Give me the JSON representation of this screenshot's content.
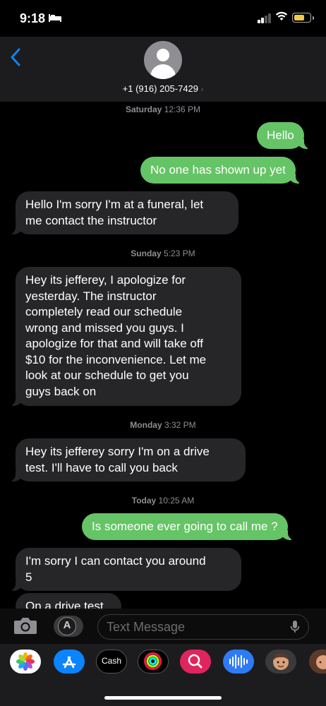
{
  "status_bar": {
    "time": "9:18"
  },
  "header": {
    "back_icon": "chevron-left-icon",
    "contact": "+1 (916) 205-7429",
    "contact_chevron": "›"
  },
  "conversation": [
    {
      "type": "timestamp",
      "day": "Saturday",
      "time": "12:36 PM"
    },
    {
      "type": "sent",
      "text": "Hello"
    },
    {
      "type": "sent",
      "text": "No one has shown up yet"
    },
    {
      "type": "received",
      "lines": [
        "Hello I'm sorry I'm at a funeral, let",
        "me contact the instructor"
      ]
    },
    {
      "type": "timestamp",
      "day": "Sunday",
      "time": "5:23 PM"
    },
    {
      "type": "received",
      "lines": [
        "Hey its jefferey, I apologize for",
        "yesterday. The instructor",
        "completely read our schedule",
        "wrong and missed you guys. I",
        "apologize for that and will take off",
        "$10 for the inconvenience. Let me",
        "look at our schedule to get you",
        "guys back on"
      ]
    },
    {
      "type": "timestamp",
      "day": "Monday",
      "time": "3:32 PM"
    },
    {
      "type": "received",
      "lines": [
        "Hey its jefferey sorry I'm on a drive",
        "test. I'll have to call you back"
      ]
    },
    {
      "type": "timestamp",
      "day": "Today",
      "time": "10:25 AM"
    },
    {
      "type": "sent",
      "text": "Is someone ever going to call me ?"
    },
    {
      "type": "received",
      "lines": [
        "I'm sorry I can contact you around",
        "5"
      ]
    },
    {
      "type": "received",
      "lines": [
        "On a drive test"
      ]
    }
  ],
  "input_bar": {
    "camera_icon": "camera-icon",
    "apps_icon": "app-store-icon",
    "placeholder": "Text Message",
    "mic_icon": "microphone-icon"
  },
  "app_drawer": {
    "apps": [
      "photos-icon",
      "app-store-icon",
      "cash-app-icon",
      "fitness-icon",
      "search-app-icon",
      "voice-memo-icon",
      "memoji-icon",
      "memoji-icon"
    ],
    "cash_label": "Cash"
  },
  "colors": {
    "sent_bubble": "#65c466",
    "received_bubble": "#262628",
    "accent": "#0a84ff"
  }
}
